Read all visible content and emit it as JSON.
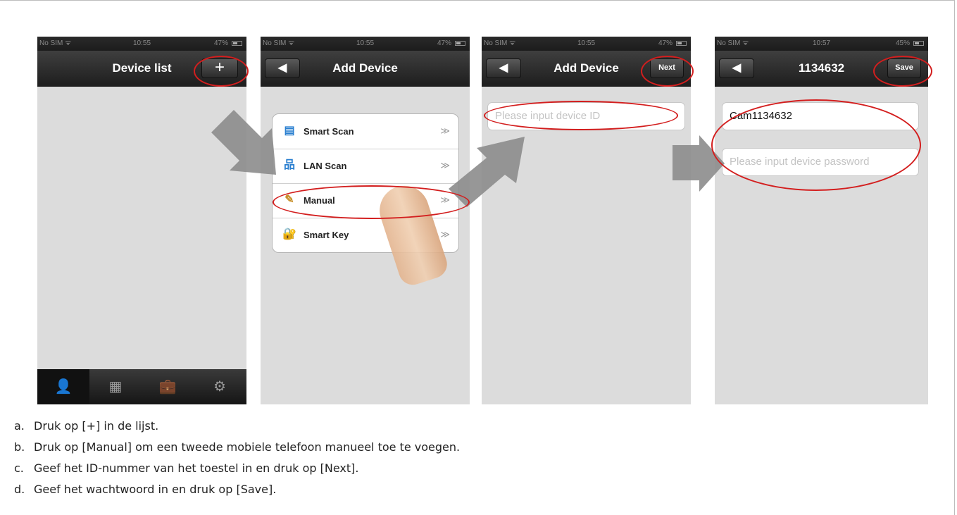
{
  "status_bars": [
    {
      "carrier": "No SIM ᯤ",
      "time": "10:55",
      "battery": "47%"
    },
    {
      "carrier": "No SIM ᯤ",
      "time": "10:55",
      "battery": "47%"
    },
    {
      "carrier": "No SIM ᯤ",
      "time": "10:55",
      "battery": "47%"
    },
    {
      "carrier": "No SIM ᯤ",
      "time": "10:57",
      "battery": "45%"
    }
  ],
  "screen1": {
    "title": "Device list",
    "add_button": "+",
    "tabs": [
      {
        "icon": "person-icon",
        "glyph": "👤"
      },
      {
        "icon": "grid-icon",
        "glyph": "▦"
      },
      {
        "icon": "briefcase-icon",
        "glyph": "💼"
      },
      {
        "icon": "gear-icon",
        "glyph": "⚙"
      }
    ]
  },
  "screen2": {
    "title": "Add Device",
    "back_glyph": "◀",
    "menu": [
      {
        "label": "Smart Scan",
        "icon": "scan-icon",
        "glyph": "▤",
        "chevron": "≫"
      },
      {
        "label": "LAN Scan",
        "icon": "network-icon",
        "glyph": "品",
        "chevron": "≫"
      },
      {
        "label": "Manual",
        "icon": "pencil-icon",
        "glyph": "✎",
        "chevron": "≫"
      },
      {
        "label": "Smart Key",
        "icon": "key-icon",
        "glyph": "🔐",
        "chevron": "≫"
      }
    ]
  },
  "screen3": {
    "title": "Add Device",
    "back_glyph": "◀",
    "next_label": "Next",
    "device_id_placeholder": "Please input device ID"
  },
  "screen4": {
    "title": "1134632",
    "back_glyph": "◀",
    "save_label": "Save",
    "device_name_value": "Cam1134632",
    "password_placeholder": "Please input device password"
  },
  "instructions": [
    {
      "letter": "a.",
      "text": "Druk op [+] in de lijst."
    },
    {
      "letter": "b.",
      "text": "Druk op [Manual] om een tweede mobiele telefoon manueel toe te voegen."
    },
    {
      "letter": "c.",
      "text": "Geef het ID-nummer van het toestel in en druk op [Next]."
    },
    {
      "letter": "d.",
      "text": "Geef het wachtwoord in en druk op [Save]."
    }
  ],
  "colors": {
    "highlight_ring": "#d31e1e",
    "arrow": "#8a8a8a",
    "active_tab": "#3aa0ff"
  }
}
